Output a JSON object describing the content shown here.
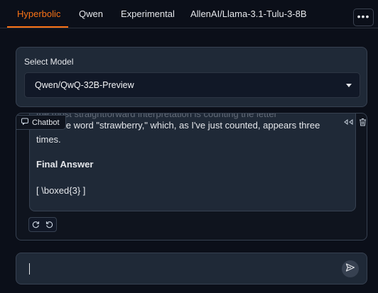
{
  "tabs": [
    {
      "label": "Hyperbolic",
      "active": true
    },
    {
      "label": "Qwen",
      "active": false
    },
    {
      "label": "Experimental",
      "active": false
    },
    {
      "label": "AllenAI/Llama-3.1-Tulu-3-8B",
      "active": false
    }
  ],
  "more_button": {
    "label": "•••"
  },
  "model_select": {
    "label": "Select Model",
    "value": "Qwen/QwQ-32B-Preview"
  },
  "chatbot": {
    "label": "Chatbot",
    "cut_off_line": "the most straightforward interpretation is counting the letter",
    "message_lines": [
      "\"r\" in the word \"strawberry,\" which, as I've just counted, appears three",
      "times."
    ],
    "final_heading": "Final Answer",
    "answer": "[ \\boxed{3} ]",
    "icons": [
      "share-icon",
      "trash-icon"
    ],
    "actions": [
      "retry-icon",
      "undo-icon"
    ]
  },
  "input": {
    "placeholder": "",
    "value": "",
    "send_icon": "send-icon"
  },
  "colors": {
    "background": "#0b0f19",
    "accent": "#f97316",
    "panel": "#1f2937",
    "border": "#374151"
  }
}
